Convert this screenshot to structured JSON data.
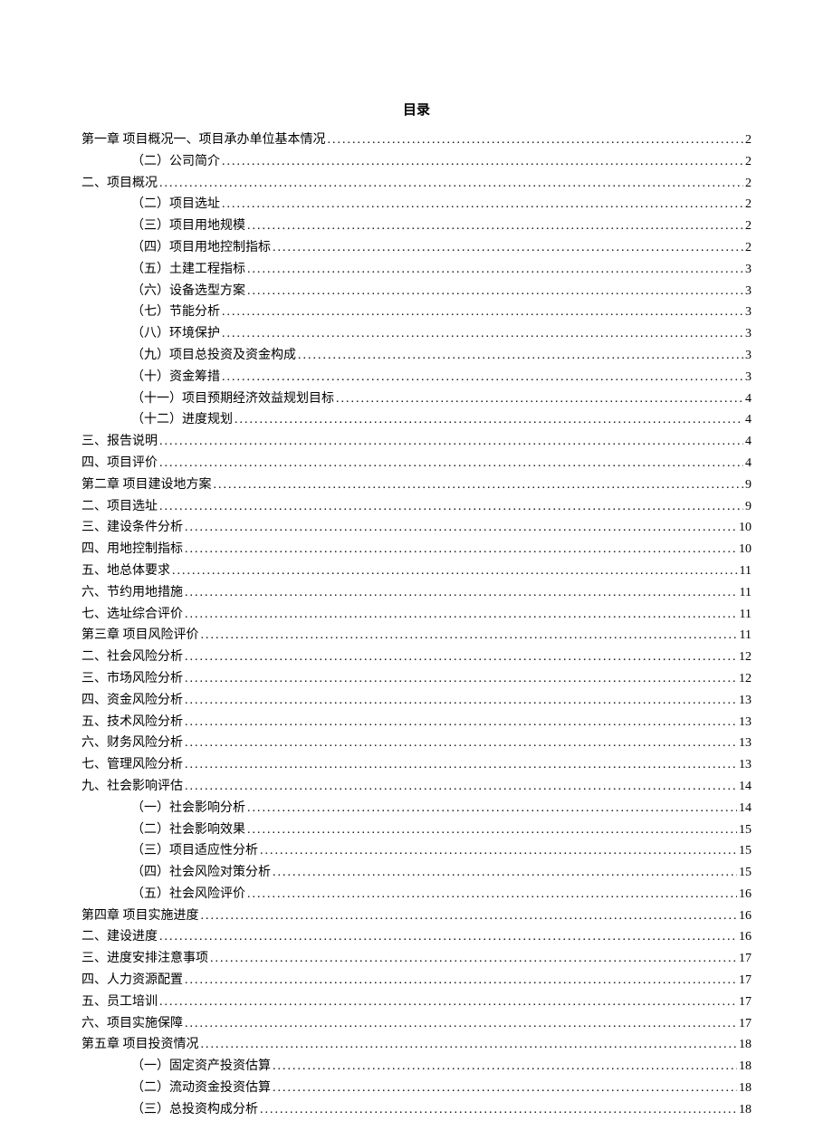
{
  "title": "目录",
  "entries": [
    {
      "label": "第一章  项目概况一、项目承办单位基本情况",
      "page": "2",
      "indent": 0
    },
    {
      "label": "（二）公司简介",
      "page": "2",
      "indent": 1
    },
    {
      "label": "二、项目概况",
      "page": "2",
      "indent": 0
    },
    {
      "label": "（二）项目选址",
      "page": "2",
      "indent": 1
    },
    {
      "label": "（三）项目用地规模",
      "page": "2",
      "indent": 1
    },
    {
      "label": "（四）项目用地控制指标",
      "page": "2",
      "indent": 1
    },
    {
      "label": "（五）土建工程指标",
      "page": "3",
      "indent": 1
    },
    {
      "label": "（六）设备选型方案",
      "page": "3",
      "indent": 1
    },
    {
      "label": "（七）节能分析",
      "page": "3",
      "indent": 1
    },
    {
      "label": "（八）环境保护",
      "page": "3",
      "indent": 1
    },
    {
      "label": "（九）项目总投资及资金构成",
      "page": "3",
      "indent": 1
    },
    {
      "label": "（十）资金筹措",
      "page": "3",
      "indent": 1
    },
    {
      "label": "（十一）项目预期经济效益规划目标",
      "page": "4",
      "indent": 1
    },
    {
      "label": "（十二）进度规划",
      "page": "4",
      "indent": 1
    },
    {
      "label": "三、报告说明",
      "page": "4",
      "indent": 0
    },
    {
      "label": "四、项目评价",
      "page": "4",
      "indent": 0
    },
    {
      "label": "第二章  项目建设地方案",
      "page": "9",
      "indent": 0
    },
    {
      "label": "二、项目选址",
      "page": "9",
      "indent": 0
    },
    {
      "label": "三、建设条件分析",
      "page": "10",
      "indent": 0
    },
    {
      "label": "四、用地控制指标",
      "page": "10",
      "indent": 0
    },
    {
      "label": "五、地总体要求",
      "page": "11",
      "indent": 0
    },
    {
      "label": "六、节约用地措施",
      "page": "11",
      "indent": 0
    },
    {
      "label": "七、选址综合评价",
      "page": "11",
      "indent": 0
    },
    {
      "label": "第三章  项目风险评价",
      "page": "11",
      "indent": 0
    },
    {
      "label": "二、社会风险分析",
      "page": "12",
      "indent": 0
    },
    {
      "label": "三、市场风险分析",
      "page": "12",
      "indent": 0
    },
    {
      "label": "四、资金风险分析",
      "page": "13",
      "indent": 0
    },
    {
      "label": "五、技术风险分析",
      "page": "13",
      "indent": 0
    },
    {
      "label": "六、财务风险分析",
      "page": "13",
      "indent": 0
    },
    {
      "label": "七、管理风险分析",
      "page": "13",
      "indent": 0
    },
    {
      "label": "九、社会影响评估",
      "page": "14",
      "indent": 0
    },
    {
      "label": "（一）社会影响分析",
      "page": "14",
      "indent": 1
    },
    {
      "label": "（二）社会影响效果",
      "page": "15",
      "indent": 1
    },
    {
      "label": "（三）项目适应性分析",
      "page": "15",
      "indent": 1
    },
    {
      "label": "（四）社会风险对策分析",
      "page": "15",
      "indent": 1
    },
    {
      "label": "（五）社会风险评价",
      "page": "16",
      "indent": 1
    },
    {
      "label": "第四章  项目实施进度",
      "page": "16",
      "indent": 0
    },
    {
      "label": "二、建设进度",
      "page": "16",
      "indent": 0
    },
    {
      "label": "三、进度安排注意事项",
      "page": "17",
      "indent": 0
    },
    {
      "label": "四、人力资源配置",
      "page": "17",
      "indent": 0
    },
    {
      "label": "五、员工培训",
      "page": "17",
      "indent": 0
    },
    {
      "label": "六、项目实施保障",
      "page": "17",
      "indent": 0
    },
    {
      "label": "第五章  项目投资情况",
      "page": "18",
      "indent": 0
    },
    {
      "label": "（一）固定资产投资估算",
      "page": "18",
      "indent": 1
    },
    {
      "label": "（二）流动资金投资估算",
      "page": "18",
      "indent": 1
    },
    {
      "label": "（三）总投资构成分析",
      "page": "18",
      "indent": 1
    }
  ]
}
